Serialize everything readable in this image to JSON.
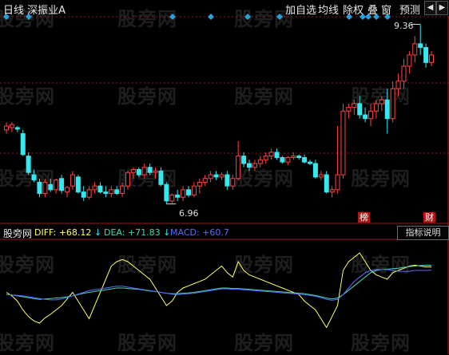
{
  "toolbar": {
    "title": "日线 深振业A",
    "buttons": [
      "加自选",
      "均线",
      "除权",
      "叠",
      "窗",
      "预测"
    ],
    "nav_prev": "◀",
    "nav_next": "▶"
  },
  "watermark": "股旁网",
  "price_chart": {
    "high_label": "9.36",
    "low_label": "6.96",
    "markers": [
      "榜",
      "财"
    ],
    "colors": {
      "up": "#ff4444",
      "down": "#35e8f0",
      "grid": "#8a1a1a",
      "diamond": "#2aa0d8"
    }
  },
  "indicator": {
    "name": "股旁网",
    "diff": "DIFF: +68.12",
    "dea": "DEA: +71.83",
    "macd": "MACD: +60.7",
    "explain_button": "指标说明",
    "colors": {
      "diff": "#ffff66",
      "dea": "#46d6b0",
      "macd": "#5a6dff"
    }
  },
  "chart_data": {
    "type": "candlestick",
    "title": "日线 深振业A",
    "series": [
      {
        "name": "ohlc",
        "values": [
          [
            7.95,
            8.05,
            7.9,
            8.0
          ],
          [
            7.98,
            8.05,
            7.92,
            8.02
          ],
          [
            7.98,
            8.0,
            7.92,
            7.96
          ],
          [
            7.9,
            7.95,
            7.6,
            7.62
          ],
          [
            7.6,
            7.65,
            7.35,
            7.38
          ],
          [
            7.35,
            7.42,
            7.25,
            7.28
          ],
          [
            7.25,
            7.3,
            7.05,
            7.1
          ],
          [
            7.1,
            7.3,
            7.05,
            7.25
          ],
          [
            7.22,
            7.3,
            7.12,
            7.15
          ],
          [
            7.15,
            7.3,
            7.1,
            7.28
          ],
          [
            7.3,
            7.35,
            7.1,
            7.14
          ],
          [
            7.12,
            7.2,
            7.05,
            7.18
          ],
          [
            7.2,
            7.4,
            7.15,
            7.35
          ],
          [
            7.32,
            7.35,
            7.1,
            7.12
          ],
          [
            7.12,
            7.2,
            7.0,
            7.05
          ],
          [
            7.05,
            7.2,
            7.02,
            7.15
          ],
          [
            7.15,
            7.25,
            7.1,
            7.2
          ],
          [
            7.2,
            7.25,
            7.1,
            7.12
          ],
          [
            7.12,
            7.2,
            7.05,
            7.1
          ],
          [
            7.1,
            7.2,
            7.05,
            7.15
          ],
          [
            7.15,
            7.2,
            7.08,
            7.1
          ],
          [
            7.1,
            7.25,
            7.05,
            7.2
          ],
          [
            7.2,
            7.4,
            7.15,
            7.38
          ],
          [
            7.38,
            7.45,
            7.3,
            7.42
          ],
          [
            7.42,
            7.45,
            7.32,
            7.35
          ],
          [
            7.35,
            7.5,
            7.3,
            7.45
          ],
          [
            7.45,
            7.5,
            7.35,
            7.38
          ],
          [
            7.38,
            7.45,
            7.3,
            7.4
          ],
          [
            7.4,
            7.45,
            7.2,
            7.22
          ],
          [
            7.22,
            7.25,
            6.96,
            7.0
          ],
          [
            7.0,
            7.1,
            6.97,
            7.08
          ],
          [
            7.08,
            7.15,
            7.0,
            7.05
          ],
          [
            7.05,
            7.2,
            7.0,
            7.15
          ],
          [
            7.15,
            7.2,
            7.05,
            7.08
          ],
          [
            7.08,
            7.25,
            7.05,
            7.2
          ],
          [
            7.2,
            7.3,
            7.1,
            7.25
          ],
          [
            7.25,
            7.35,
            7.2,
            7.3
          ],
          [
            7.3,
            7.4,
            7.25,
            7.35
          ],
          [
            7.35,
            7.4,
            7.28,
            7.32
          ],
          [
            7.32,
            7.38,
            7.28,
            7.35
          ],
          [
            7.35,
            7.4,
            7.15,
            7.2
          ],
          [
            7.2,
            7.35,
            7.15,
            7.3
          ],
          [
            7.3,
            7.8,
            7.28,
            7.6
          ],
          [
            7.6,
            7.65,
            7.45,
            7.5
          ],
          [
            7.5,
            7.55,
            7.4,
            7.45
          ],
          [
            7.45,
            7.55,
            7.4,
            7.5
          ],
          [
            7.5,
            7.6,
            7.45,
            7.55
          ],
          [
            7.55,
            7.65,
            7.5,
            7.6
          ],
          [
            7.6,
            7.7,
            7.55,
            7.65
          ],
          [
            7.65,
            7.7,
            7.55,
            7.58
          ],
          [
            7.58,
            7.6,
            7.5,
            7.52
          ],
          [
            7.52,
            7.6,
            7.48,
            7.58
          ],
          [
            7.58,
            7.65,
            7.55,
            7.6
          ],
          [
            7.6,
            7.62,
            7.55,
            7.58
          ],
          [
            7.58,
            7.62,
            7.5,
            7.52
          ],
          [
            7.52,
            7.55,
            7.48,
            7.5
          ],
          [
            7.5,
            7.55,
            7.3,
            7.32
          ],
          [
            7.32,
            7.4,
            7.28,
            7.35
          ],
          [
            7.35,
            7.4,
            7.1,
            7.12
          ],
          [
            7.12,
            7.2,
            7.05,
            7.15
          ],
          [
            7.15,
            8.0,
            7.1,
            7.35
          ],
          [
            7.35,
            8.3,
            7.3,
            8.2
          ],
          [
            8.2,
            8.3,
            8.1,
            8.25
          ],
          [
            8.25,
            8.35,
            8.15,
            8.3
          ],
          [
            8.3,
            8.4,
            8.1,
            8.15
          ],
          [
            8.15,
            8.25,
            8.05,
            8.1
          ],
          [
            8.1,
            8.3,
            8.0,
            8.2
          ],
          [
            8.2,
            8.35,
            8.1,
            8.3
          ],
          [
            8.3,
            8.4,
            8.2,
            8.35
          ],
          [
            8.35,
            8.5,
            7.9,
            8.1
          ],
          [
            8.1,
            8.6,
            8.05,
            8.5
          ],
          [
            8.5,
            8.7,
            8.4,
            8.6
          ],
          [
            8.6,
            8.9,
            8.5,
            8.8
          ],
          [
            8.8,
            9.0,
            8.7,
            8.95
          ],
          [
            8.95,
            9.2,
            8.85,
            9.1
          ],
          [
            9.1,
            9.36,
            8.95,
            9.05
          ],
          [
            9.05,
            9.1,
            8.78,
            8.85
          ],
          [
            8.85,
            9.0,
            8.8,
            8.95
          ]
        ]
      }
    ],
    "price_labels": {
      "high": 9.36,
      "low": 6.96
    },
    "indicator_series": [
      {
        "name": "DIFF",
        "values": [
          10,
          2,
          -10,
          -30,
          -45,
          -55,
          -60,
          -48,
          -40,
          -30,
          -20,
          -5,
          10,
          -10,
          -30,
          -50,
          -20,
          10,
          40,
          70,
          80,
          85,
          80,
          70,
          60,
          50,
          40,
          20,
          0,
          -20,
          -10,
          10,
          20,
          25,
          30,
          35,
          40,
          50,
          60,
          70,
          55,
          45,
          80,
          60,
          50,
          45,
          40,
          35,
          30,
          25,
          20,
          15,
          10,
          5,
          -10,
          -20,
          -30,
          -50,
          -70,
          -45,
          -20,
          60,
          80,
          90,
          100,
          80,
          60,
          50,
          45,
          40,
          55,
          60,
          65,
          70,
          72,
          70,
          68,
          68
        ]
      },
      {
        "name": "DEA",
        "values": [
          5,
          4,
          2,
          0,
          -2,
          -4,
          -6,
          -5,
          -4,
          -3,
          -2,
          0,
          2,
          5,
          8,
          10,
          12,
          14,
          16,
          18,
          20,
          20,
          19,
          18,
          17,
          15,
          13,
          12,
          10,
          8,
          7,
          7,
          8,
          9,
          10,
          12,
          14,
          16,
          18,
          20,
          20,
          19,
          19,
          18,
          17,
          16,
          15,
          14,
          13,
          12,
          11,
          10,
          9,
          8,
          7,
          5,
          3,
          0,
          -3,
          -5,
          -3,
          5,
          15,
          25,
          35,
          45,
          55,
          60,
          62,
          63,
          64,
          65,
          67,
          69,
          70,
          71,
          72,
          71.83
        ]
      },
      {
        "name": "MACD",
        "values": [
          5,
          4,
          3,
          2,
          0,
          -2,
          -4,
          -6,
          -7,
          -7,
          -5,
          -2,
          2,
          6,
          10,
          14,
          16,
          18,
          20,
          22,
          24,
          24,
          22,
          20,
          18,
          16,
          14,
          12,
          10,
          8,
          6,
          5,
          6,
          7,
          8,
          10,
          12,
          14,
          16,
          18,
          18,
          17,
          17,
          16,
          15,
          14,
          13,
          12,
          11,
          10,
          9,
          8,
          7,
          6,
          5,
          3,
          1,
          -2,
          -6,
          -8,
          -6,
          5,
          20,
          35,
          45,
          55,
          60,
          62,
          62,
          62,
          60,
          58,
          58,
          58,
          60,
          60,
          60,
          60.7
        ]
      }
    ]
  }
}
